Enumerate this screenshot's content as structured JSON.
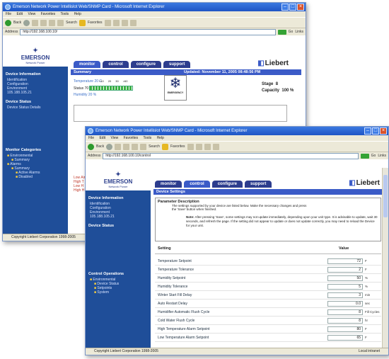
{
  "back_window": {
    "title": "Emerson Network Power Intellislot Web/SNMP Card - Microsoft Internet Explorer",
    "menu": [
      "File",
      "Edit",
      "View",
      "Favorites",
      "Tools",
      "Help"
    ],
    "toolbar": {
      "back": "Back",
      "search": "Search",
      "favorites": "Favorites"
    },
    "address": "http://192.168.100.10/",
    "go_label": "Go",
    "links_label": "Links",
    "logo": {
      "name": "EMERSON",
      "sub": "Network Power"
    },
    "sidebar": {
      "device_info_title": "Device Information",
      "device_info_items": [
        "Identification",
        "Configuration",
        "Environment",
        "105.188.105.21"
      ],
      "device_status_title": "Device Status",
      "device_status_items": [
        "Device Status Details"
      ],
      "monitor_title": "Monitor Categories",
      "monitor_items": [
        "Environmental",
        "Summary",
        "Alarms",
        "Summary",
        "Active Alarms",
        "Disabled"
      ]
    },
    "tabs": [
      "monitor",
      "control",
      "configure",
      "support"
    ],
    "brand": "Liebert",
    "summary_label": "Summary",
    "updated_label": "Updated: November 11, 2005 08:48:56 PM",
    "temperature": {
      "label": "Temperature 20 C",
      "status_label": "Status 70",
      "range_label": "Humidity 20 %",
      "scale": [
        "<10",
        "20",
        "30",
        ">60"
      ]
    },
    "alarm_icon_label": "EMERGENCY",
    "stage_label": "Stage",
    "stage_value": "8",
    "capacity_label": "Capacity",
    "capacity_value": "100 %",
    "status_text": "Copyright Liebert Corporation 1998-2005",
    "warnings": [
      "Low Air",
      "High T",
      "Low H",
      "High H"
    ]
  },
  "front_window": {
    "title": "Emerson Network Power Intellislot Web/SNMP Card - Microsoft Internet Explorer",
    "menu": [
      "File",
      "Edit",
      "View",
      "Favorites",
      "Tools",
      "Help"
    ],
    "toolbar": {
      "back": "Back",
      "search": "Search",
      "favorites": "Favorites"
    },
    "address": "http://192.168.100.10/control",
    "go_label": "Go",
    "links_label": "Links",
    "logo": {
      "name": "EMERSON",
      "sub": "Network Power"
    },
    "sidebar": {
      "device_info_title": "Device Information",
      "device_info_items": [
        "Identification",
        "Configuration",
        "Environment",
        "105.188.105.21"
      ],
      "device_status_title": "Device Status",
      "control_title": "Control Operations",
      "control_items": [
        "Environmental",
        "Device Status",
        "Setpoints",
        "System"
      ]
    },
    "tabs": [
      "monitor",
      "control",
      "configure",
      "support"
    ],
    "brand": "Liebert",
    "section_title": "Device Settings",
    "param_header": "Parameter Description",
    "param_lines": [
      "The settings supported by your device are listed below. Make the necessary changes and press",
      "the 'Save' button when finished."
    ],
    "note_label": "Note:",
    "note_text": "After pressing 'Save', some settings may not update immediately, depending upon your unit type. It is advisable to update, wait 30 seconds, and refresh the page. If the setting did not appear to update or does not update correctly, you may need to reload the Device for your unit.",
    "table_header": {
      "setting": "Setting",
      "value": "Value"
    },
    "settings": [
      {
        "name": "Temperature Setpoint",
        "value": "72",
        "unit": "F"
      },
      {
        "name": "Temperature Tolerance",
        "value": "2",
        "unit": "F"
      },
      {
        "name": "Humidity Setpoint",
        "value": "50",
        "unit": "%"
      },
      {
        "name": "Humidity Tolerance",
        "value": "5",
        "unit": "%"
      },
      {
        "name": "Winter Start Fill Delay",
        "value": "3",
        "unit": "min"
      },
      {
        "name": "Auto Restart Delay",
        "value": "0.0",
        "unit": "sec"
      },
      {
        "name": "Humidifier Automatic Flush Cycle",
        "value": "8",
        "unit": "Fill Cycles"
      },
      {
        "name": "Cold Water Flush Cycle",
        "value": "8",
        "unit": "hr"
      },
      {
        "name": "High Temperature Alarm Setpoint",
        "value": "80",
        "unit": "F"
      },
      {
        "name": "Low Temperature Alarm Setpoint",
        "value": "65",
        "unit": "F"
      }
    ],
    "status_text": "Copyright Liebert Corporation 1998-2005",
    "zone_text": "Local intranet"
  }
}
